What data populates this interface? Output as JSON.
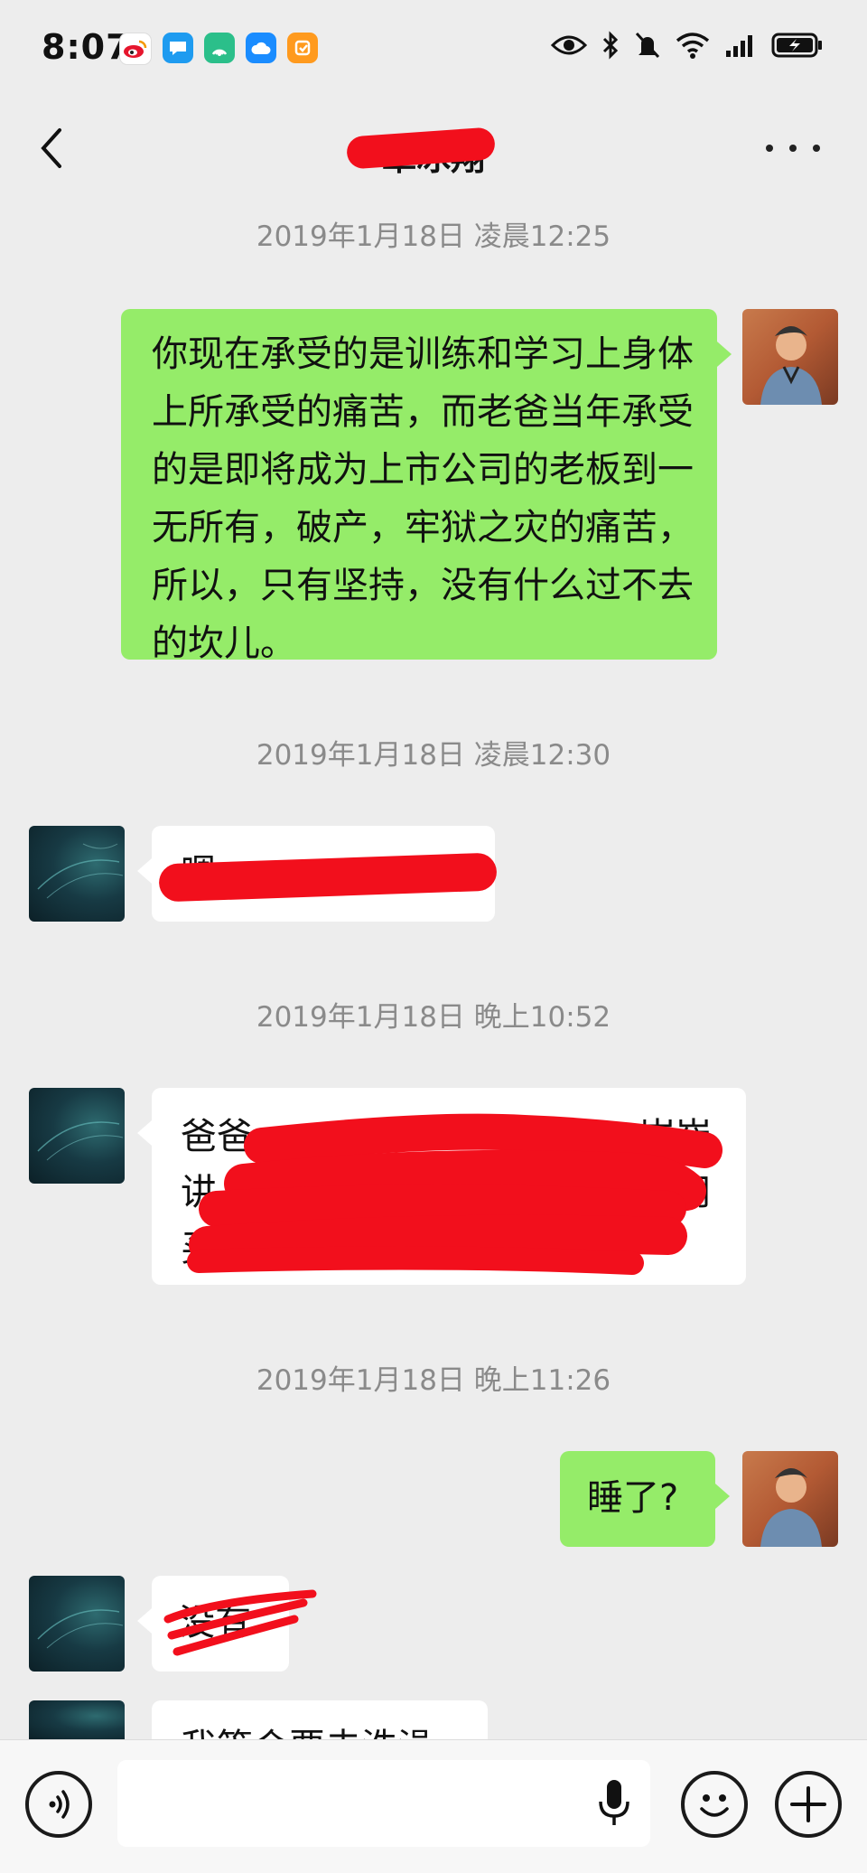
{
  "status_bar": {
    "time": "8:07",
    "app_icons": [
      "weibo-icon",
      "messages-icon",
      "signal-app-icon",
      "cloud-icon",
      "notes-icon"
    ],
    "status_icons": [
      "eye-icon",
      "bluetooth-icon",
      "mute-icon",
      "wifi-icon",
      "cellular-icon",
      "battery-icon"
    ]
  },
  "header": {
    "title": "覃冰翔",
    "more_label": "..."
  },
  "messages": [
    {
      "timestamp": "2019年1月18日 凌晨12:25"
    },
    {
      "sender": "me",
      "text": "你现在承受的是训练和学习上身体上所承受的痛苦，而老爸当年承受的是即将成为上市公司的老板到一无所有，破产，牢狱之灾的痛苦，所以，只有坚持，没有什么过不去的坎儿。"
    },
    {
      "timestamp": "2019年1月18日 凌晨12:30"
    },
    {
      "sender": "other",
      "text": "嗯"
    },
    {
      "timestamp": "2019年1月18日 晚上10:52"
    },
    {
      "sender": "other",
      "line1_start": "爸爸",
      "line1_end": "崔崔",
      "line2_start": "讲",
      "line2_end": "不用",
      "line3_start": "买了"
    },
    {
      "timestamp": "2019年1月18日 晚上11:26"
    },
    {
      "sender": "me",
      "text": "睡了?"
    },
    {
      "sender": "other",
      "text": "没有"
    },
    {
      "sender": "other",
      "text": "我等会要去洗澡"
    }
  ],
  "input_bar": {
    "placeholder": ""
  },
  "colors": {
    "background": "#ededed",
    "outgoing_bubble": "#95ec69",
    "incoming_bubble": "#ffffff",
    "redaction": "#f20f1c"
  }
}
